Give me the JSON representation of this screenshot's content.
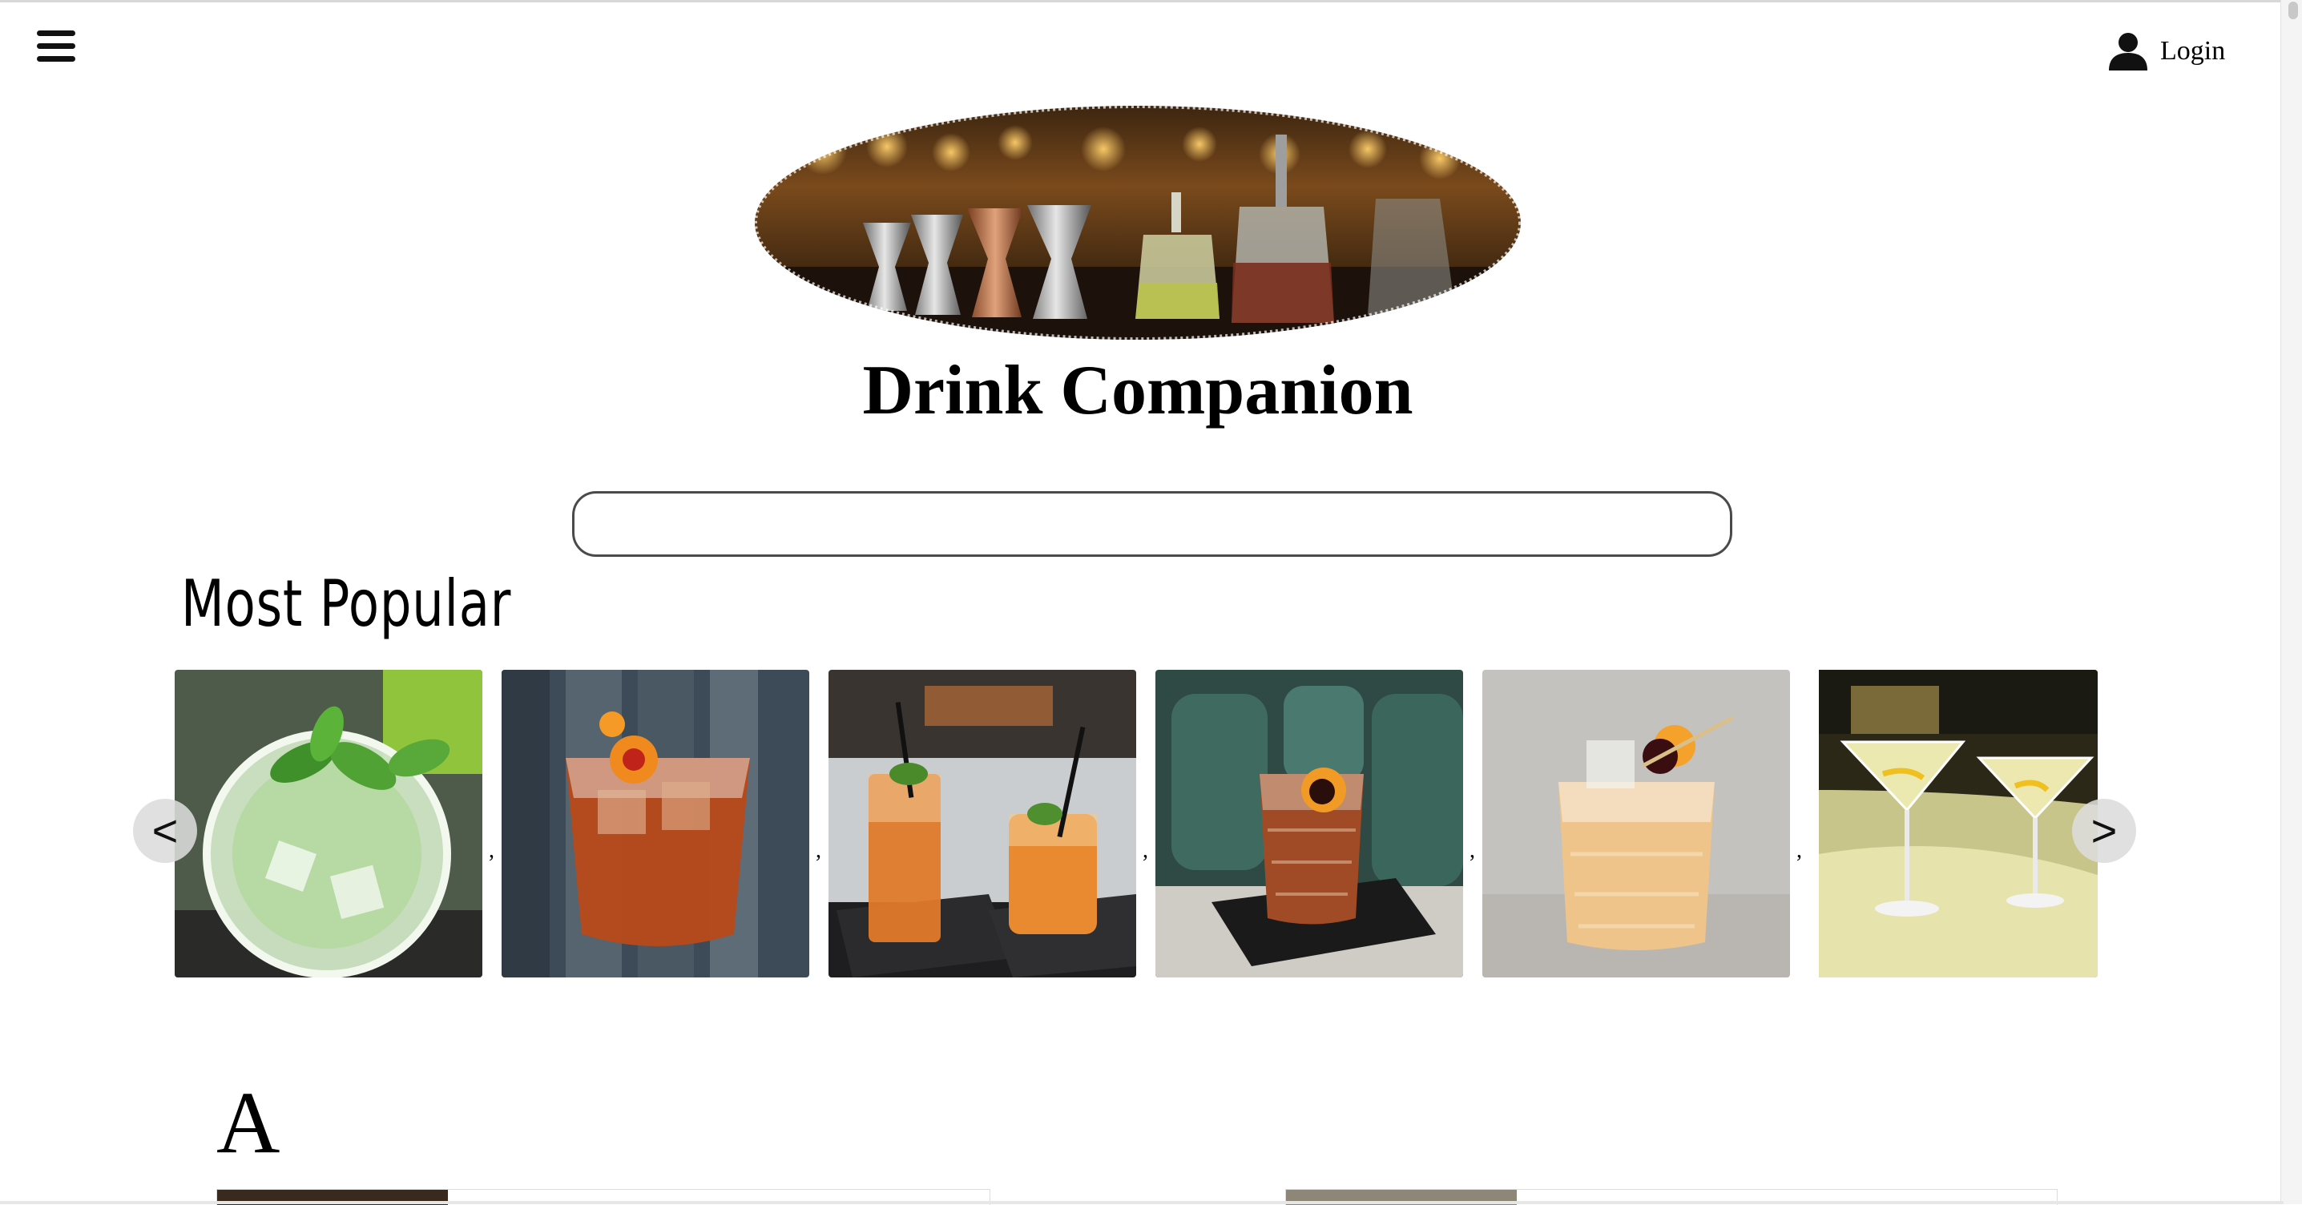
{
  "header": {
    "menu_icon": "hamburger-icon",
    "login_icon": "user-icon",
    "login_label": "Login"
  },
  "hero": {
    "image": "bar-tools-photo",
    "title": "Drink Companion"
  },
  "search": {
    "value": "",
    "placeholder": ""
  },
  "popular": {
    "heading": "Most Popular",
    "prev_label": "<",
    "next_label": ">",
    "separator": ",",
    "items": [
      {
        "image": "mojito-photo"
      },
      {
        "image": "negroni-photo"
      },
      {
        "image": "tall-iced-tea-cocktails-photo"
      },
      {
        "image": "old-fashioned-photo"
      },
      {
        "image": "whiskey-sour-photo"
      },
      {
        "image": "martini-photo"
      }
    ]
  },
  "index": {
    "letter": "A"
  },
  "colors": {
    "background": "#ffffff",
    "text": "#000000",
    "search_border": "#4a4a4a",
    "arrow_bg": "#dcdcdc"
  }
}
